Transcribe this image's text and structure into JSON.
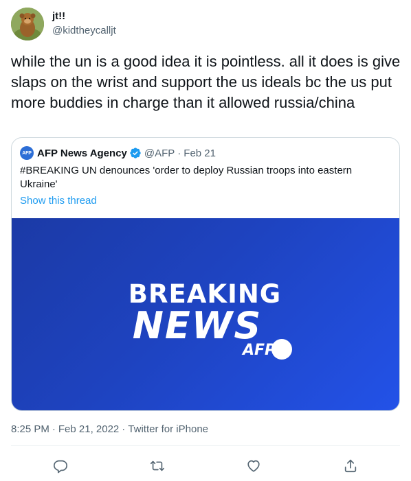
{
  "author": {
    "display_name": "jt!!",
    "handle": "@kidtheycalljt",
    "avatar_icon": "avatar-image"
  },
  "tweet": {
    "text": "while the un is a good idea it is pointless. all it does is give slaps on the wrist and support the us ideals bc the us put more buddies in charge than it allowed russia/china"
  },
  "quote": {
    "avatar_label": "AFP",
    "name": "AFP News Agency",
    "verified_icon": "verified-badge-icon",
    "handle": "@AFP",
    "separator": "·",
    "date": "Feb 21",
    "text": "#BREAKING UN denounces 'order to deploy Russian troops into eastern Ukraine'",
    "link": "Show this thread",
    "media": {
      "line1": "BREAKING",
      "line2": "NEWS",
      "brand": "AFP",
      "background_color": "#1e43c0"
    }
  },
  "meta": {
    "time": "8:25 PM",
    "date": "Feb 21, 2022",
    "source": "Twitter for iPhone",
    "separator": "·"
  },
  "actions": {
    "reply_icon": "reply-icon",
    "retweet_icon": "retweet-icon",
    "like_icon": "like-icon",
    "share_icon": "share-icon"
  },
  "colors": {
    "text": "#0f1419",
    "secondary": "#536471",
    "link": "#1d9bf0",
    "border": "#cfd9de"
  }
}
